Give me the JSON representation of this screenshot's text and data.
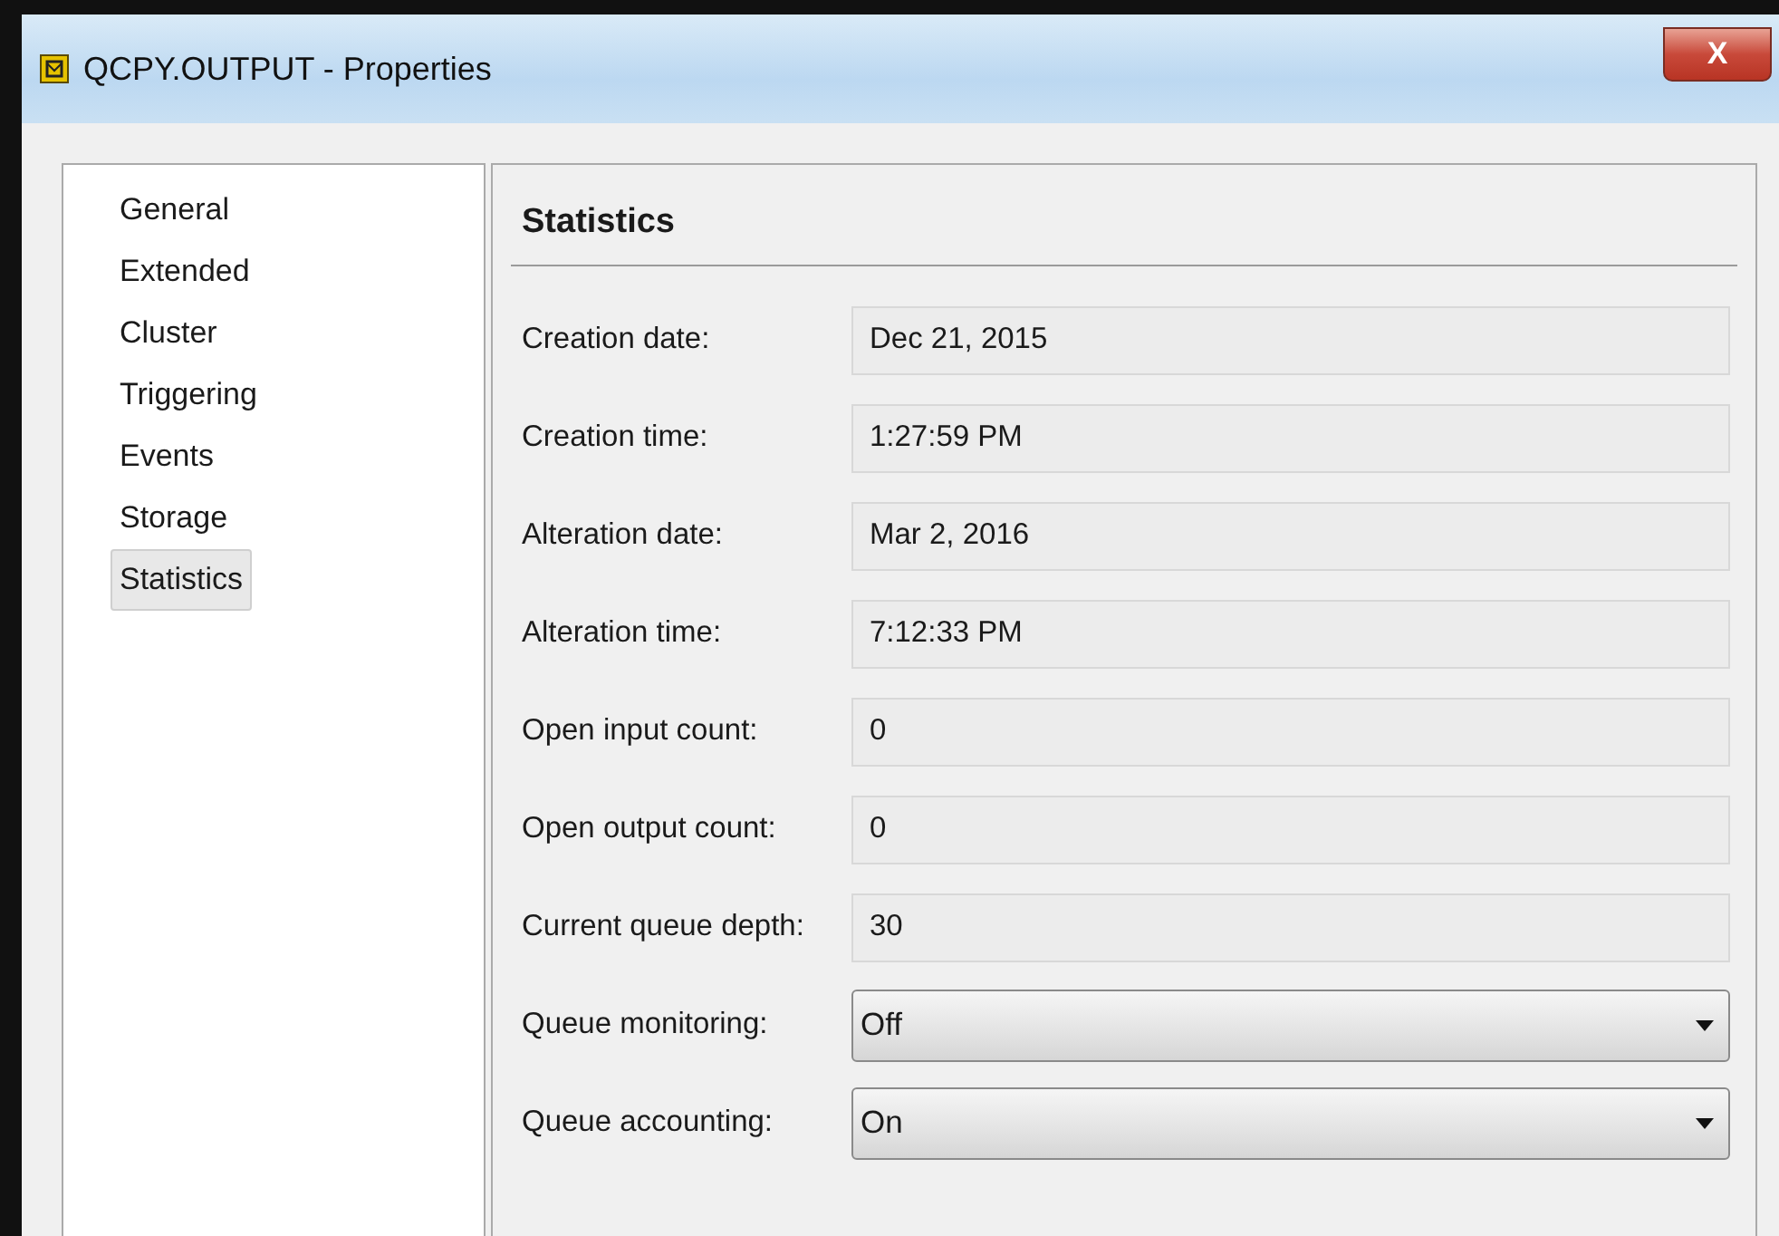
{
  "window": {
    "title": "QCPY.OUTPUT - Properties",
    "close_label": "X"
  },
  "sidebar": {
    "items": [
      {
        "label": "General",
        "selected": false
      },
      {
        "label": "Extended",
        "selected": false
      },
      {
        "label": "Cluster",
        "selected": false
      },
      {
        "label": "Triggering",
        "selected": false
      },
      {
        "label": "Events",
        "selected": false
      },
      {
        "label": "Storage",
        "selected": false
      },
      {
        "label": "Statistics",
        "selected": true
      }
    ]
  },
  "panel": {
    "title": "Statistics",
    "fields": [
      {
        "label": "Creation date:",
        "value": "Dec 21, 2015",
        "kind": "text"
      },
      {
        "label": "Creation time:",
        "value": "1:27:59 PM",
        "kind": "text"
      },
      {
        "label": "Alteration date:",
        "value": "Mar 2, 2016",
        "kind": "text"
      },
      {
        "label": "Alteration time:",
        "value": "7:12:33 PM",
        "kind": "text"
      },
      {
        "label": "Open input count:",
        "value": "0",
        "kind": "text"
      },
      {
        "label": "Open output count:",
        "value": "0",
        "kind": "text"
      },
      {
        "label": "Current queue depth:",
        "value": "30",
        "kind": "text"
      },
      {
        "label": "Queue monitoring:",
        "value": "Off",
        "kind": "select"
      },
      {
        "label": "Queue accounting:",
        "value": "On",
        "kind": "select"
      }
    ]
  }
}
